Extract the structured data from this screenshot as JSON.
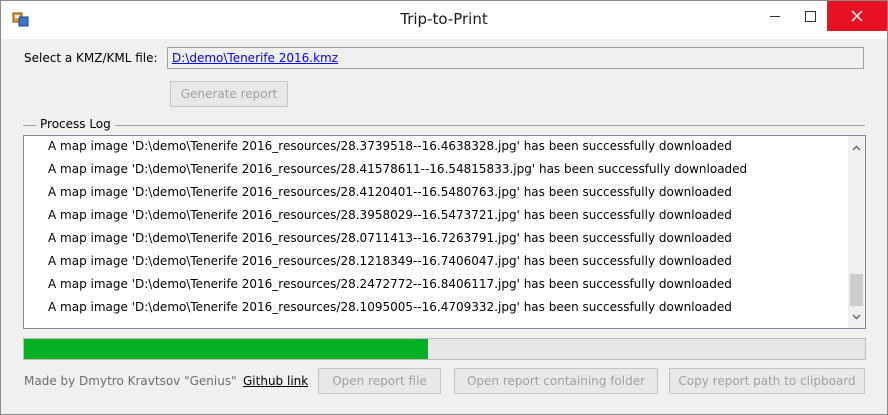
{
  "window": {
    "title": "Trip-to-Print"
  },
  "file": {
    "label": "Select a KMZ/KML file:",
    "path": "D:\\demo\\Tenerife 2016.kmz"
  },
  "buttons": {
    "generate": "Generate report",
    "open_report": "Open report file",
    "open_folder": "Open report containing folder",
    "copy_path": "Copy report path to clipboard"
  },
  "process_log": {
    "title": "Process Log",
    "lines": [
      "A map image 'D:\\demo\\Tenerife 2016_resources/28.3739518--16.4638328.jpg' has been successfully downloaded",
      "A map image 'D:\\demo\\Tenerife 2016_resources/28.41578611--16.54815833.jpg' has been successfully downloaded",
      "A map image 'D:\\demo\\Tenerife 2016_resources/28.4120401--16.5480763.jpg' has been successfully downloaded",
      "A map image 'D:\\demo\\Tenerife 2016_resources/28.3958029--16.5473721.jpg' has been successfully downloaded",
      "A map image 'D:\\demo\\Tenerife 2016_resources/28.0711413--16.7263791.jpg' has been successfully downloaded",
      "A map image 'D:\\demo\\Tenerife 2016_resources/28.1218349--16.7406047.jpg' has been successfully downloaded",
      "A map image 'D:\\demo\\Tenerife 2016_resources/28.2472772--16.8406117.jpg' has been successfully downloaded",
      "A map image 'D:\\demo\\Tenerife 2016_resources/28.1095005--16.4709332.jpg' has been successfully downloaded"
    ]
  },
  "progress": {
    "fraction": 0.48,
    "color": "#06b025"
  },
  "footer": {
    "made_by": "Made by Dmytro Kravtsov \"Genius\"",
    "github_link": "Github link"
  },
  "icons": {
    "app": "app-icon",
    "minimize": "minimize-icon",
    "maximize": "maximize-icon",
    "close": "close-icon"
  },
  "colors": {
    "close_button": "#e81123",
    "link": "#0000ff"
  }
}
